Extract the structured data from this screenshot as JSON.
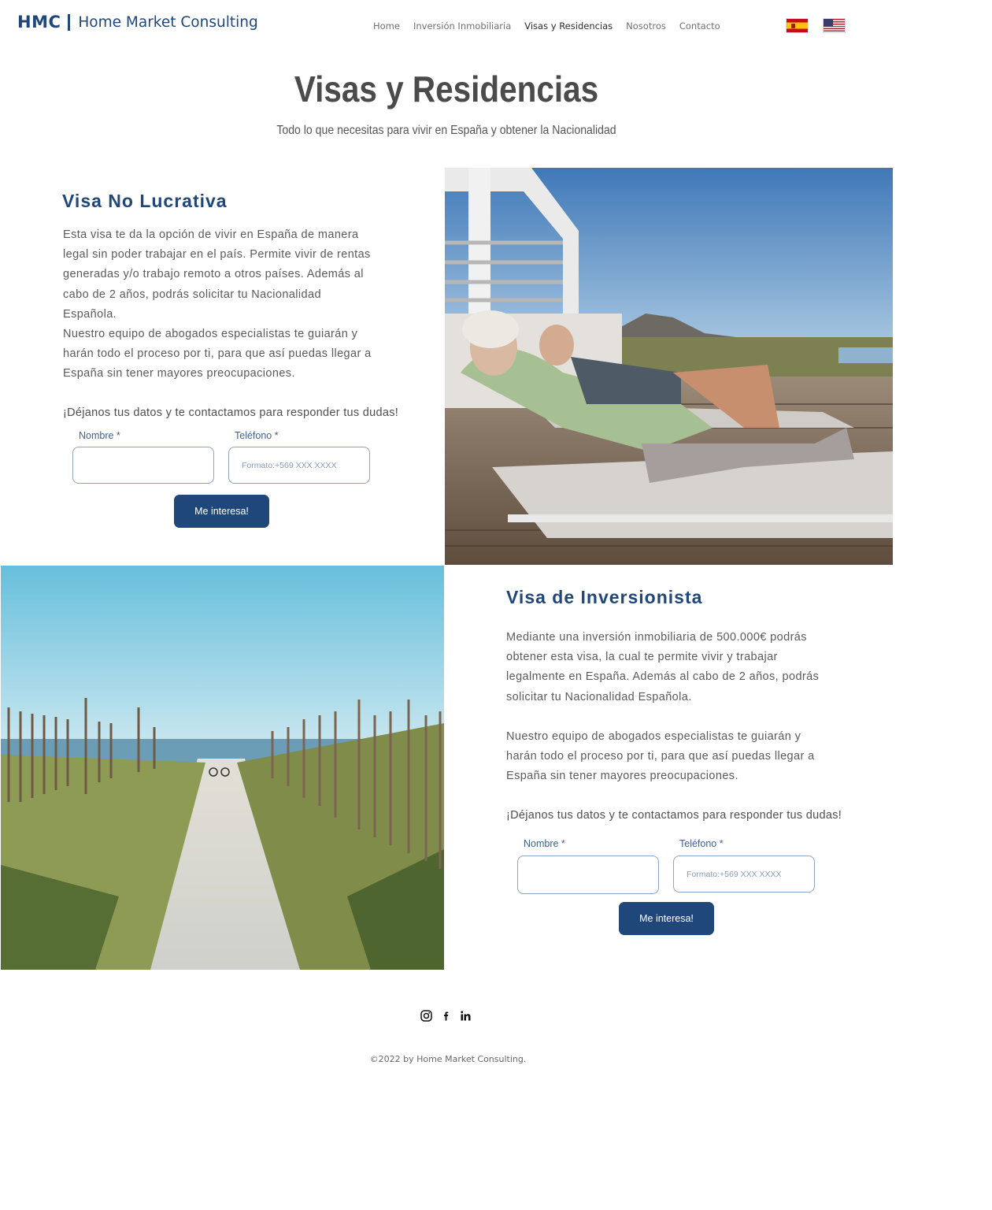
{
  "header": {
    "logo_mark": "HMC",
    "logo_text": "Home Market Consulting",
    "nav": [
      {
        "label": "Home"
      },
      {
        "label": "Inversión Inmobiliaria"
      },
      {
        "label": "Visas y Residencias",
        "active": true
      },
      {
        "label": "Nosotros"
      },
      {
        "label": "Contacto"
      }
    ],
    "languages": [
      "spain-flag-icon",
      "usa-flag-icon"
    ]
  },
  "hero": {
    "title": "Visas y Residencias",
    "subtitle": "Todo lo que necesitas para vivir en España y obtener la Nacionalidad"
  },
  "visa_no_lucrativa": {
    "title": "Visa No Lucrativa",
    "paragraph1": "Esta visa te da la opción de vivir en España de manera legal sin poder trabajar en el país. Permite vivir de rentas generadas y/o trabajo remoto a otros países. Además al cabo de 2 años, podrás solicitar tu Nacionalidad Española.",
    "paragraph2": "Nuestro equipo de abogados especialistas te guiarán y harán todo el proceso por ti, para que así puedas llegar a España sin tener mayores preocupaciones.",
    "cta": "¡Déjanos tus datos y te contactamos para responder tus dudas!",
    "form": {
      "name_label": "Nombre *",
      "name_value": "",
      "phone_label": "Teléfono *",
      "phone_placeholder": "Formato:+569 XXX XXXX",
      "submit_label": "Me interesa!"
    }
  },
  "visa_inversionista": {
    "title": "Visa de Inversionista",
    "paragraph1": "Mediante una inversión inmobiliaria de 500.000€ podrás obtener esta visa, la cual te permite vivir y trabajar legalmente en España. Además al cabo de 2 años, podrás solicitar tu Nacionalidad Española.",
    "paragraph2": "Nuestro equipo de abogados especialistas te guiarán y harán todo el proceso por ti, para que así puedas llegar a España sin tener mayores preocupaciones.",
    "cta": "¡Déjanos tus datos y te contactamos para responder tus dudas!",
    "form": {
      "name_label": "Nombre *",
      "name_value": "",
      "phone_label": "Teléfono *",
      "phone_placeholder": "Formato:+569 XXX XXXX",
      "submit_label": "Me interesa!"
    }
  },
  "footer": {
    "social": [
      "instagram-icon",
      "facebook-icon",
      "linkedin-icon"
    ],
    "copyright": "©2022 by Home Market Consulting."
  },
  "colors": {
    "brand": "#1f4779",
    "input_border": "#8fa3c6",
    "text": "#5a5a5a"
  }
}
